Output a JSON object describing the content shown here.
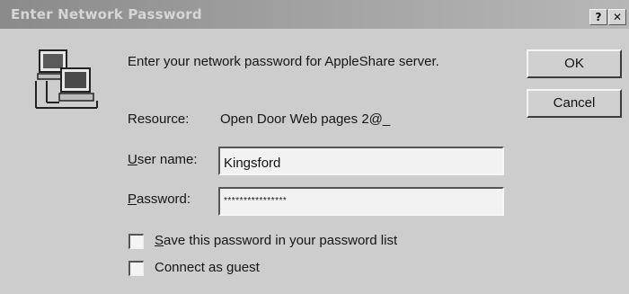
{
  "window": {
    "title": "Enter Network Password",
    "help_glyph": "?",
    "close_glyph": "✕"
  },
  "dialog": {
    "prompt": "Enter your network password for AppleShare server.",
    "resource_label": "Resource:",
    "resource_value": "Open Door Web pages 2@_",
    "username_label_prefix": "U",
    "username_label_rest": "ser name:",
    "username_value": "Kingsford",
    "password_label_prefix": "P",
    "password_label_rest": "assword:",
    "password_value": "****************",
    "save_password_prefix": "S",
    "save_password_rest": "ave this password in your password list",
    "save_password_checked": false,
    "guest_prefix": "Connect as ",
    "guest_underlined": "g",
    "guest_rest": "uest",
    "guest_checked": false
  },
  "buttons": {
    "ok_label": "OK",
    "cancel_label": "Cancel"
  },
  "icons": {
    "network": "network-computers-icon"
  },
  "colors": {
    "titlebar_start": "#8a8a8a",
    "titlebar_end": "#b7b7b7",
    "face": "#cdcdcd"
  }
}
